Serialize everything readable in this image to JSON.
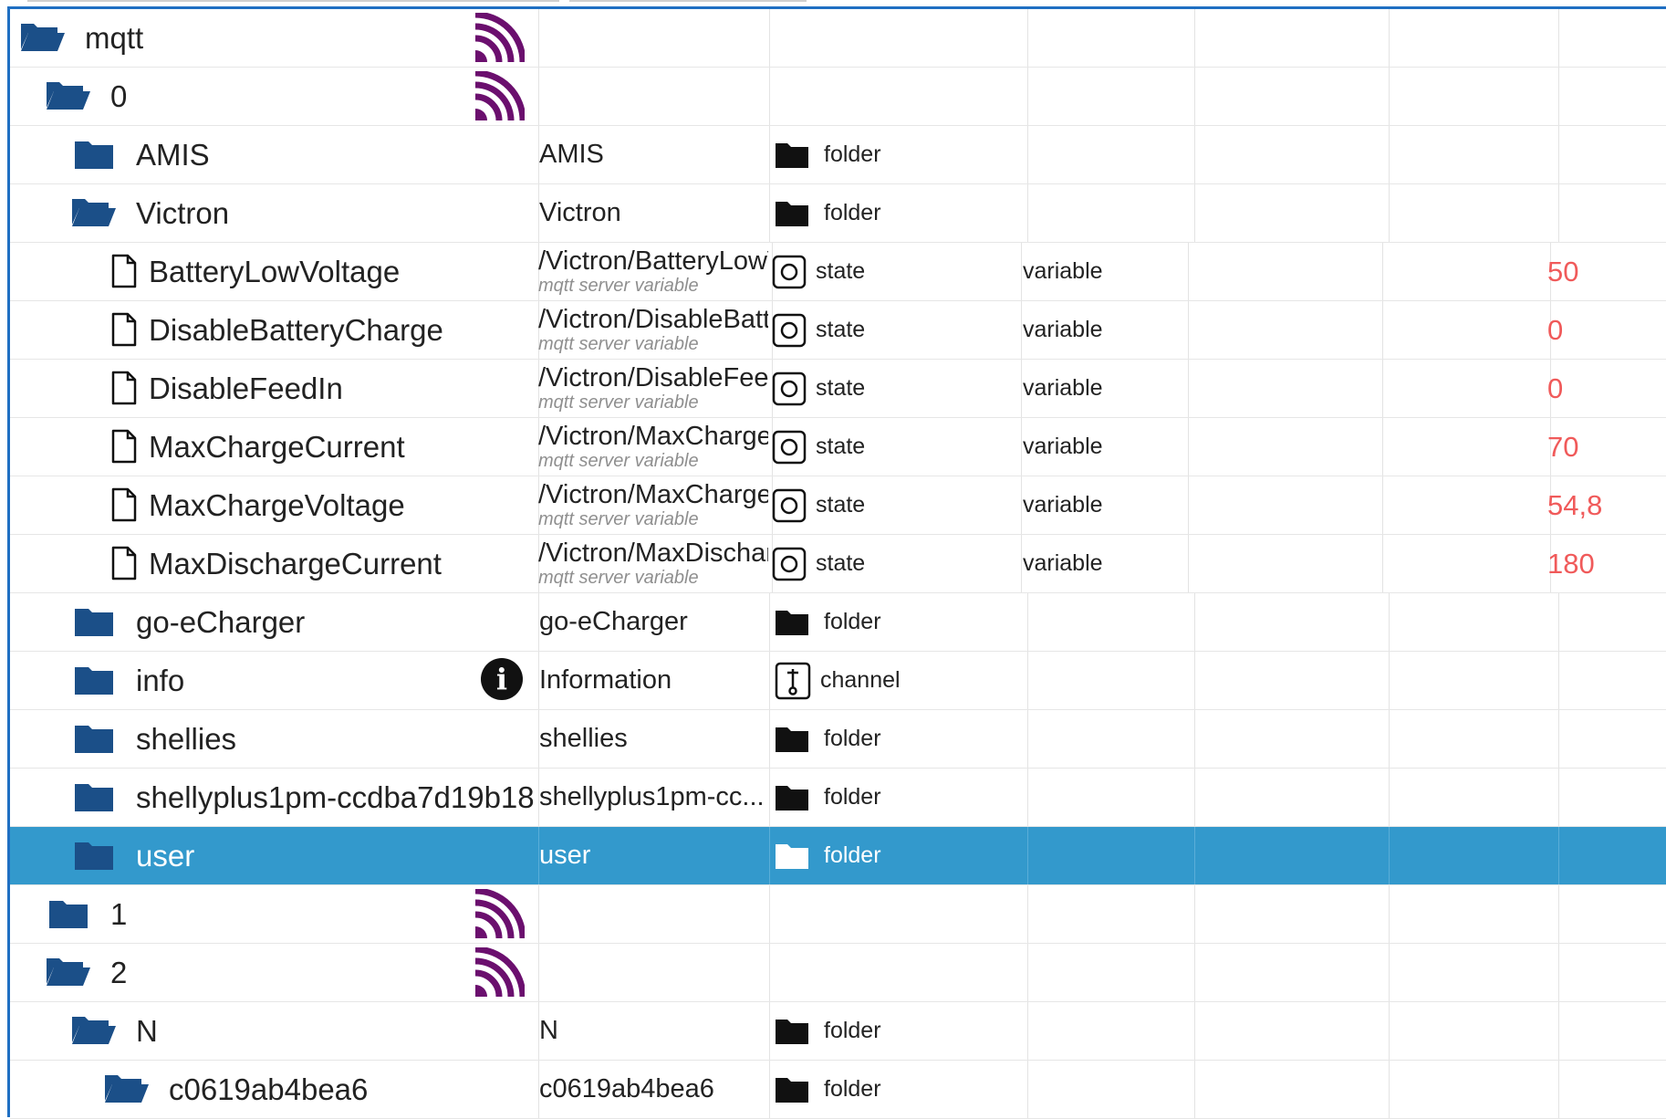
{
  "colors": {
    "accent": "#1f6fc2",
    "selected_bg": "#3399cc",
    "folder_blue": "#1b4f88",
    "mqtt_purple": "#6b0f6e",
    "value_red": "#f05a5a"
  },
  "rows": [
    {
      "level": 0,
      "icon": "folder-open-icon",
      "name": "mqtt",
      "adapter_icon": "mqtt-icon"
    },
    {
      "level": 1,
      "icon": "folder-open-icon",
      "name": "0",
      "adapter_icon": "mqtt-icon"
    },
    {
      "level": 2,
      "icon": "folder-closed-icon",
      "name": "AMIS",
      "display_name": "AMIS",
      "type_icon": "folder-black-icon",
      "type": "folder"
    },
    {
      "level": 2,
      "icon": "folder-open-icon",
      "name": "Victron",
      "display_name": "Victron",
      "type_icon": "folder-black-icon",
      "type": "folder"
    },
    {
      "level": 3,
      "icon": "file-icon",
      "name": "BatteryLowVoltage",
      "display_name": "/Victron/BatteryLowVoltage",
      "description": "mqtt server variable",
      "type_icon": "state-icon",
      "type": "state",
      "role": "variable",
      "value": "50"
    },
    {
      "level": 3,
      "icon": "file-icon",
      "name": "DisableBatteryCharge",
      "display_name": "/Victron/DisableBatteryCharge",
      "description": "mqtt server variable",
      "type_icon": "state-icon",
      "type": "state",
      "role": "variable",
      "value": "0"
    },
    {
      "level": 3,
      "icon": "file-icon",
      "name": "DisableFeedIn",
      "display_name": "/Victron/DisableFeedIn",
      "description": "mqtt server variable",
      "type_icon": "state-icon",
      "type": "state",
      "role": "variable",
      "value": "0"
    },
    {
      "level": 3,
      "icon": "file-icon",
      "name": "MaxChargeCurrent",
      "display_name": "/Victron/MaxChargeCurrent",
      "description": "mqtt server variable",
      "type_icon": "state-icon",
      "type": "state",
      "role": "variable",
      "value": "70"
    },
    {
      "level": 3,
      "icon": "file-icon",
      "name": "MaxChargeVoltage",
      "display_name": "/Victron/MaxChargeVoltage",
      "description": "mqtt server variable",
      "type_icon": "state-icon",
      "type": "state",
      "role": "variable",
      "value": "54,8"
    },
    {
      "level": 3,
      "icon": "file-icon",
      "name": "MaxDischargeCurrent",
      "display_name": "/Victron/MaxDischargeCurrent",
      "description": "mqtt server variable",
      "type_icon": "state-icon",
      "type": "state",
      "role": "variable",
      "value": "180"
    },
    {
      "level": 2,
      "icon": "folder-closed-icon",
      "name": "go-eCharger",
      "display_name": "go-eCharger",
      "type_icon": "folder-black-icon",
      "type": "folder"
    },
    {
      "level": 2,
      "icon": "folder-closed-icon",
      "name": "info",
      "adapter_icon": "info-icon",
      "display_name": "Information",
      "type_icon": "channel-icon",
      "type": "channel"
    },
    {
      "level": 2,
      "icon": "folder-closed-icon",
      "name": "shellies",
      "display_name": "shellies",
      "type_icon": "folder-black-icon",
      "type": "folder"
    },
    {
      "level": 2,
      "icon": "folder-closed-icon",
      "name": "shellyplus1pm-ccdba7d19b18",
      "display_name": "shellyplus1pm-cc...",
      "type_icon": "folder-black-icon",
      "type": "folder"
    },
    {
      "level": 2,
      "icon": "folder-closed-icon",
      "name": "user",
      "display_name": "user",
      "type_icon": "folder-white-icon",
      "type": "folder",
      "selected": true
    },
    {
      "level": 1,
      "icon": "folder-closed-icon",
      "name": "1",
      "adapter_icon": "mqtt-icon"
    },
    {
      "level": 1,
      "icon": "folder-open-icon",
      "name": "2",
      "adapter_icon": "mqtt-icon"
    },
    {
      "level": 2,
      "icon": "folder-open-icon",
      "name": "N",
      "display_name": "N",
      "type_icon": "folder-black-icon",
      "type": "folder"
    },
    {
      "level": 3,
      "icon": "folder-open-icon",
      "name": "c0619ab4bea6",
      "display_name": "c0619ab4bea6",
      "type_icon": "folder-black-icon",
      "type": "folder"
    }
  ]
}
